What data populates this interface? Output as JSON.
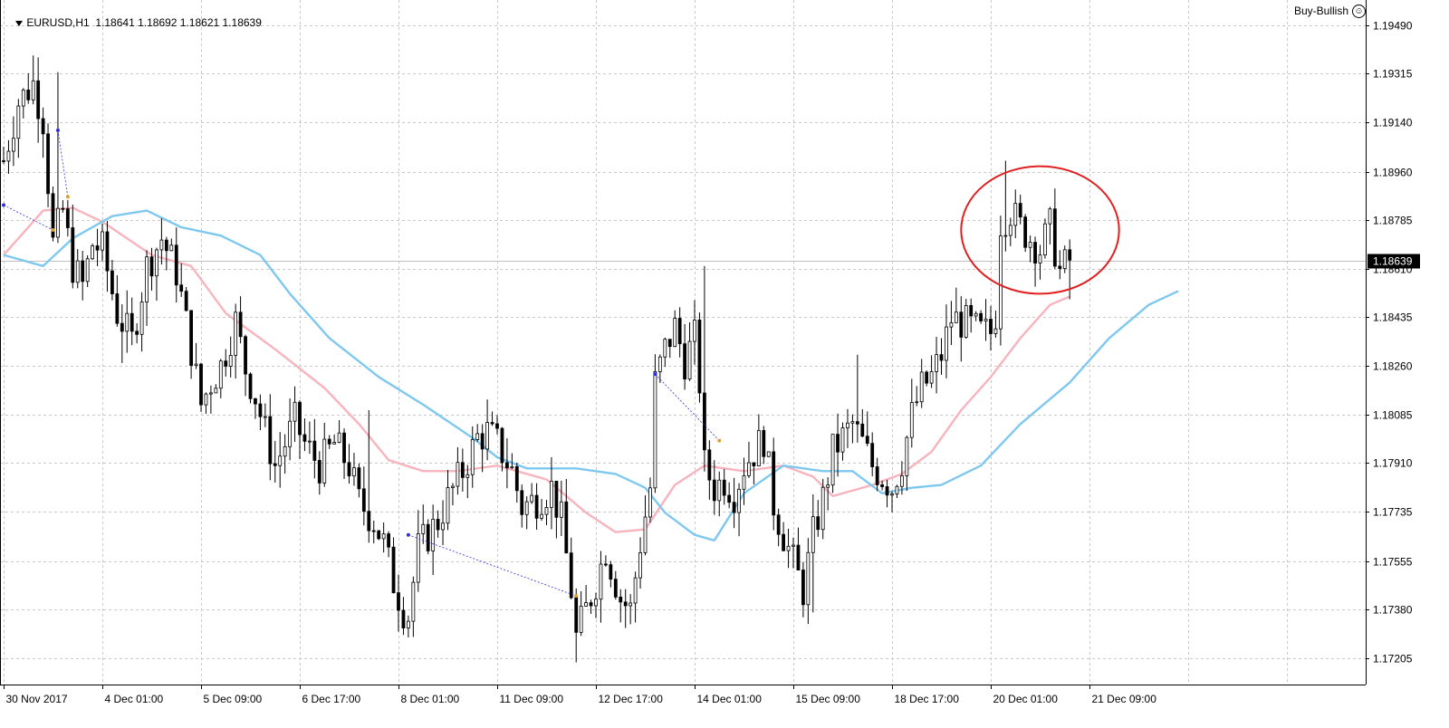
{
  "header": {
    "symbol_timeframe": "EURUSD,H1",
    "ohlc": "1.18641 1.18692 1.18621 1.18639"
  },
  "expert": {
    "label": "Buy-Bullish",
    "icon": "smiley-icon"
  },
  "colors": {
    "candle": "#000000",
    "ma_fast": "#f8b3bd",
    "ma_slow": "#7ec8f0",
    "grid": "#c8c8c8",
    "highlight_circle": "#e02020",
    "current_price_bg": "#000000",
    "zigzag": "#3030e0"
  },
  "chart_data": {
    "type": "candlestick",
    "title": "",
    "ylim": [
      1.1711,
      1.1958
    ],
    "y_ticks": [
      "1.19490",
      "1.19315",
      "1.19140",
      "1.18960",
      "1.18785",
      "1.18610",
      "1.18435",
      "1.18260",
      "1.18085",
      "1.17910",
      "1.17735",
      "1.17555",
      "1.17380",
      "1.17205"
    ],
    "y_tick_values": [
      1.1949,
      1.19315,
      1.1914,
      1.1896,
      1.18785,
      1.1861,
      1.18435,
      1.1826,
      1.18085,
      1.1791,
      1.17735,
      1.17555,
      1.1738,
      1.17205
    ],
    "x_ticks": [
      "30 Nov 2017",
      "4 Dec 01:00",
      "5 Dec 09:00",
      "6 Dec 17:00",
      "8 Dec 01:00",
      "11 Dec 09:00",
      "12 Dec 17:00",
      "14 Dec 01:00",
      "15 Dec 09:00",
      "18 Dec 17:00",
      "20 Dec 01:00",
      "21 Dec 09:00"
    ],
    "x_tick_bar_index": [
      0,
      20,
      40,
      60,
      80,
      100,
      120,
      140,
      160,
      180,
      200,
      220
    ],
    "current_price": "1.18639",
    "current_price_value": 1.18639,
    "price_path": [
      [
        0,
        1.19
      ],
      [
        3,
        1.1921
      ],
      [
        6,
        1.1928
      ],
      [
        8,
        1.1915
      ],
      [
        10,
        1.187
      ],
      [
        12,
        1.1882
      ],
      [
        14,
        1.1862
      ],
      [
        16,
        1.1855
      ],
      [
        18,
        1.187
      ],
      [
        20,
        1.1868
      ],
      [
        23,
        1.1845
      ],
      [
        26,
        1.1835
      ],
      [
        29,
        1.1862
      ],
      [
        32,
        1.1872
      ],
      [
        35,
        1.186
      ],
      [
        38,
        1.1832
      ],
      [
        40,
        1.1812
      ],
      [
        42,
        1.182
      ],
      [
        44,
        1.1826
      ],
      [
        47,
        1.1842
      ],
      [
        49,
        1.1825
      ],
      [
        51,
        1.1815
      ],
      [
        53,
        1.1802
      ],
      [
        55,
        1.179
      ],
      [
        57,
        1.1798
      ],
      [
        59,
        1.1806
      ],
      [
        61,
        1.1798
      ],
      [
        64,
        1.179
      ],
      [
        67,
        1.1798
      ],
      [
        70,
        1.179
      ],
      [
        72,
        1.1777
      ],
      [
        75,
        1.177
      ],
      [
        77,
        1.1762
      ],
      [
        79,
        1.1748
      ],
      [
        81,
        1.1738
      ],
      [
        82,
        1.1736
      ],
      [
        84,
        1.176
      ],
      [
        86,
        1.1765
      ],
      [
        88,
        1.177
      ],
      [
        90,
        1.1778
      ],
      [
        93,
        1.1788
      ],
      [
        96,
        1.18
      ],
      [
        98,
        1.1802
      ],
      [
        100,
        1.1798
      ],
      [
        103,
        1.1788
      ],
      [
        105,
        1.1775
      ],
      [
        108,
        1.1778
      ],
      [
        111,
        1.1782
      ],
      [
        113,
        1.177
      ],
      [
        115,
        1.1745
      ],
      [
        116,
        1.1728
      ],
      [
        118,
        1.1738
      ],
      [
        120,
        1.1748
      ],
      [
        122,
        1.176
      ],
      [
        125,
        1.1742
      ],
      [
        127,
        1.1738
      ],
      [
        129,
        1.1762
      ],
      [
        131,
        1.1782
      ],
      [
        132,
        1.182
      ],
      [
        134,
        1.1832
      ],
      [
        136,
        1.184
      ],
      [
        138,
        1.1828
      ],
      [
        140,
        1.1836
      ],
      [
        141,
        1.182
      ],
      [
        142,
        1.179
      ],
      [
        144,
        1.1782
      ],
      [
        146,
        1.1785
      ],
      [
        148,
        1.178
      ],
      [
        150,
        1.179
      ],
      [
        152,
        1.1795
      ],
      [
        154,
        1.18
      ],
      [
        156,
        1.1776
      ],
      [
        158,
        1.1765
      ],
      [
        160,
        1.1755
      ],
      [
        162,
        1.1745
      ],
      [
        164,
        1.1765
      ],
      [
        166,
        1.1778
      ],
      [
        168,
        1.1795
      ],
      [
        170,
        1.18
      ],
      [
        172,
        1.1805
      ],
      [
        174,
        1.1798
      ],
      [
        176,
        1.179
      ],
      [
        178,
        1.1786
      ],
      [
        180,
        1.1782
      ],
      [
        182,
        1.1792
      ],
      [
        184,
        1.1808
      ],
      [
        186,
        1.1818
      ],
      [
        188,
        1.1822
      ],
      [
        190,
        1.183
      ],
      [
        192,
        1.1843
      ],
      [
        194,
        1.1842
      ],
      [
        196,
        1.184
      ],
      [
        198,
        1.1838
      ],
      [
        200,
        1.1838
      ],
      [
        201,
        1.1845
      ],
      [
        202,
        1.1878
      ],
      [
        204,
        1.1882
      ],
      [
        206,
        1.1876
      ],
      [
        208,
        1.1872
      ],
      [
        210,
        1.1868
      ],
      [
        212,
        1.1876
      ],
      [
        214,
        1.186
      ],
      [
        216,
        1.1864
      ]
    ],
    "spikes": [
      {
        "bar": 6,
        "high": 1.1938
      },
      {
        "bar": 11,
        "high": 1.1932
      },
      {
        "bar": 24,
        "low": 1.1827
      },
      {
        "bar": 74,
        "high": 1.181
      },
      {
        "bar": 82,
        "low": 1.1728
      },
      {
        "bar": 116,
        "low": 1.1719
      },
      {
        "bar": 142,
        "high": 1.1862
      },
      {
        "bar": 164,
        "low": 1.1737
      },
      {
        "bar": 173,
        "high": 1.183
      },
      {
        "bar": 203,
        "high": 1.19
      },
      {
        "bar": 213,
        "high": 1.189
      },
      {
        "bar": 216,
        "low": 1.185
      }
    ],
    "series": [
      {
        "kind": "ma_fast",
        "points": [
          [
            0,
            1.1866
          ],
          [
            8,
            1.1882
          ],
          [
            14,
            1.1883
          ],
          [
            20,
            1.1878
          ],
          [
            30,
            1.1866
          ],
          [
            38,
            1.1862
          ],
          [
            45,
            1.1845
          ],
          [
            55,
            1.1832
          ],
          [
            65,
            1.1818
          ],
          [
            72,
            1.1805
          ],
          [
            78,
            1.1792
          ],
          [
            85,
            1.1788
          ],
          [
            92,
            1.1788
          ],
          [
            100,
            1.179
          ],
          [
            110,
            1.1785
          ],
          [
            118,
            1.1773
          ],
          [
            124,
            1.1766
          ],
          [
            130,
            1.1767
          ],
          [
            136,
            1.1783
          ],
          [
            142,
            1.179
          ],
          [
            150,
            1.1788
          ],
          [
            158,
            1.179
          ],
          [
            164,
            1.1786
          ],
          [
            168,
            1.1779
          ],
          [
            176,
            1.1783
          ],
          [
            182,
            1.1787
          ],
          [
            188,
            1.1795
          ],
          [
            194,
            1.181
          ],
          [
            200,
            1.1822
          ],
          [
            206,
            1.1836
          ],
          [
            212,
            1.1848
          ],
          [
            216,
            1.1851
          ]
        ]
      },
      {
        "kind": "ma_slow",
        "points": [
          [
            0,
            1.1866
          ],
          [
            8,
            1.1862
          ],
          [
            14,
            1.1872
          ],
          [
            22,
            1.188
          ],
          [
            29,
            1.1882
          ],
          [
            36,
            1.1876
          ],
          [
            44,
            1.1873
          ],
          [
            52,
            1.1866
          ],
          [
            58,
            1.1852
          ],
          [
            66,
            1.1836
          ],
          [
            76,
            1.1822
          ],
          [
            85,
            1.1812
          ],
          [
            95,
            1.18
          ],
          [
            100,
            1.1793
          ],
          [
            106,
            1.1789
          ],
          [
            116,
            1.1789
          ],
          [
            124,
            1.1787
          ],
          [
            130,
            1.1782
          ],
          [
            134,
            1.1773
          ],
          [
            140,
            1.1765
          ],
          [
            144,
            1.1763
          ],
          [
            150,
            1.178
          ],
          [
            158,
            1.179
          ],
          [
            166,
            1.1788
          ],
          [
            172,
            1.1788
          ],
          [
            178,
            1.178
          ],
          [
            184,
            1.1782
          ],
          [
            190,
            1.1783
          ],
          [
            198,
            1.179
          ],
          [
            206,
            1.1805
          ],
          [
            216,
            1.182
          ],
          [
            224,
            1.1836
          ],
          [
            232,
            1.1848
          ],
          [
            238,
            1.1853
          ]
        ]
      }
    ],
    "zigzag_segments": [
      [
        [
          0,
          1.1884
        ],
        [
          10,
          1.1875
        ]
      ],
      [
        [
          82,
          1.1765
        ],
        [
          116,
          1.1743
        ]
      ],
      [
        [
          132,
          1.1823
        ],
        [
          145,
          1.1799
        ]
      ],
      [
        [
          11,
          1.1911
        ],
        [
          13,
          1.1887
        ]
      ]
    ],
    "highlight_ellipse": {
      "bar_center": 210,
      "price_center": 1.1875,
      "bar_radius": 16,
      "price_radius": 0.0023
    }
  }
}
